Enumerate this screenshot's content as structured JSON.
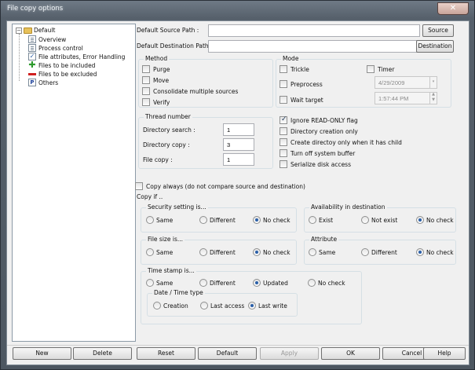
{
  "window": {
    "title": "File copy options",
    "close_glyph": "✕"
  },
  "tree": {
    "root": "Default",
    "items": [
      "Overview",
      "Process control",
      "File attributes, Error Handling",
      "Files to be included",
      "Files to be excluded",
      "Others"
    ]
  },
  "paths": {
    "source_label": "Default Source Path :",
    "destination_label": "Default Destination Path :",
    "source_value": "",
    "destination_value": "",
    "source_button": "Source",
    "destination_button": "Destination"
  },
  "method": {
    "title": "Method",
    "options": [
      {
        "label": "Purge",
        "checked": false
      },
      {
        "label": "Move",
        "checked": false
      },
      {
        "label": "Consolidate multiple sources",
        "checked": false
      },
      {
        "label": "Verify",
        "checked": false
      }
    ]
  },
  "mode": {
    "title": "Mode",
    "trickle": "Trickle",
    "timer": "Timer",
    "preprocess": "Preprocess",
    "preprocess_date": "4/29/2009",
    "wait_target": "Wait target",
    "wait_time": "1:57:44 PM"
  },
  "thread": {
    "title": "Thread number",
    "directory_search_label": "Directory search :",
    "directory_search_value": "1",
    "directory_copy_label": "Directory copy :",
    "directory_copy_value": "3",
    "file_copy_label": "File copy :",
    "file_copy_value": "1"
  },
  "flags": [
    {
      "label": "Ignore READ-ONLY flag",
      "checked": true
    },
    {
      "label": "Directory creation only",
      "checked": false
    },
    {
      "label": "Create directoy only when it has child",
      "checked": false
    },
    {
      "label": "Turn off system buffer",
      "checked": false
    },
    {
      "label": "Serialize disk access",
      "checked": false
    }
  ],
  "copy_always": {
    "label": "Copy always (do not compare source and destination)",
    "checked": false
  },
  "copy_if": {
    "title": "Copy if ..",
    "security": {
      "title": "Security setting is...",
      "options": [
        "Same",
        "Different",
        "No check"
      ],
      "selected": 2
    },
    "availability": {
      "title": "Availability in destination",
      "options": [
        "Exist",
        "Not exist",
        "No check"
      ],
      "selected": 2
    },
    "file_size": {
      "title": "File size is...",
      "options": [
        "Same",
        "Different",
        "No check"
      ],
      "selected": 2
    },
    "attribute": {
      "title": "Attribute",
      "options": [
        "Same",
        "Different",
        "No check"
      ],
      "selected": 2
    },
    "time_stamp": {
      "title": "Time stamp is...",
      "options": [
        "Same",
        "Different",
        "Updated",
        "No check"
      ],
      "selected": 2
    },
    "date_time_type": {
      "title": "Date / Time type",
      "options": [
        "Creation",
        "Last access",
        "Last write"
      ],
      "selected": 2
    }
  },
  "buttons": {
    "new": "New",
    "delete": "Delete",
    "reset": "Reset",
    "default": "Default",
    "apply": "Apply",
    "ok": "OK",
    "cancel": "Cancel",
    "help": "Help"
  }
}
